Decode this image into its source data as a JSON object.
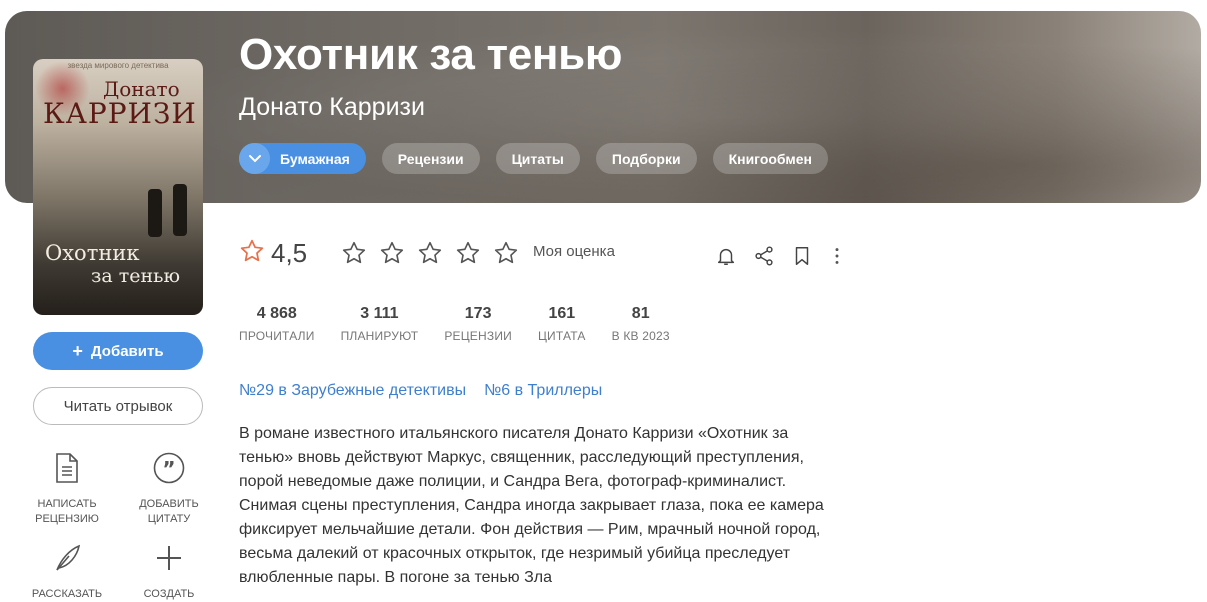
{
  "book": {
    "title": "Охотник за тенью",
    "author": "Донато Карризи"
  },
  "tabs": [
    {
      "label": "Бумажная",
      "active": true
    },
    {
      "label": "Рецензии"
    },
    {
      "label": "Цитаты"
    },
    {
      "label": "Подборки"
    },
    {
      "label": "Книгообмен"
    }
  ],
  "cover": {
    "series_text": "звезда мирового детектива",
    "author_first": "Донато",
    "author_last": "КАРРИЗИ",
    "title_line1": "Охотник",
    "title_line2": "за тенью"
  },
  "sidebar": {
    "add_label": "Добавить",
    "read_label": "Читать отрывок",
    "actions": [
      {
        "label1": "НАПИСАТЬ",
        "label2": "РЕЦЕНЗИЮ",
        "icon": "document-icon"
      },
      {
        "label1": "ДОБАВИТЬ",
        "label2": "ЦИТАТУ",
        "icon": "quote-icon"
      },
      {
        "label1": "РАССКАЗАТЬ",
        "label2": "",
        "icon": "feather-icon"
      },
      {
        "label1": "СОЗДАТЬ",
        "label2": "",
        "icon": "plus-icon"
      }
    ]
  },
  "rating": {
    "value": "4,5",
    "my_rating_label": "Моя оценка",
    "stars_total": 5,
    "accent": "#e8704a"
  },
  "stats": [
    {
      "value": "4 868",
      "label": "ПРОЧИТАЛИ"
    },
    {
      "value": "3 111",
      "label": "ПЛАНИРУЮТ"
    },
    {
      "value": "173",
      "label": "РЕЦЕНЗИИ"
    },
    {
      "value": "161",
      "label": "ЦИТАТА"
    },
    {
      "value": "81",
      "label": "В КВ 2023"
    }
  ],
  "ranks": [
    {
      "label": "№29 в Зарубежные детективы"
    },
    {
      "label": "№6 в Триллеры"
    }
  ],
  "description": "В романе известного итальянского писателя Донато Карризи «Охотник за тенью» вновь действуют Маркус, священник, расследующий преступления, порой неведомые даже полиции, и Сандра Вега, фотограф-криминалист. Снимая сцены преступления, Сандра иногда закрывает глаза, пока ее камера фиксирует мельчайшие детали. Фон действия — Рим, мрачный ночной город, весьма далекий от красочных открыток, где незримый убийца преследует влюбленные пары. В погоне за тенью Зла",
  "colors": {
    "primary": "#4a90e2",
    "link": "#3e7fcf"
  }
}
